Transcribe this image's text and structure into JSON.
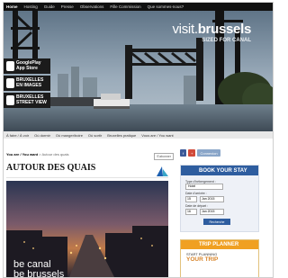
{
  "topnav": {
    "home": "Home",
    "items": [
      "Hosting",
      "Guide",
      "Presse",
      "Observations",
      "Fille Commission",
      "Que sommes-nous?"
    ]
  },
  "hero": {
    "logo_prefix": "visit.",
    "logo_brand": "brussels",
    "logo_sub": "SIZED FOR CANAL",
    "badges": [
      {
        "line1": "GooglePlay",
        "line2": "App Store"
      },
      {
        "line1": "BRUXELLES",
        "line2": "EN IMAGES"
      },
      {
        "line1": "BRUXELLES",
        "line2": "STREET VIEW"
      }
    ]
  },
  "strip": {
    "items": [
      "À faire / À voir",
      "Où dormir",
      "Où manger/boire",
      "Où sortir",
      "Bruxelles pratique",
      "Vous are / You want"
    ]
  },
  "breadcrumb": {
    "lead": "You are / You want",
    "trail": "Autour des quais"
  },
  "toolbar": {
    "b1": "f",
    "b2": "+",
    "b3": "Connexion"
  },
  "article": {
    "title": "AUTOUR DES QUAIS",
    "subscribe": "S'abonner",
    "caption_line1": "be canal",
    "caption_line2": "be brussels"
  },
  "book": {
    "header": "BOOK YOUR STAY",
    "type_label": "Type d'hébergement :",
    "type_value": "Hotel",
    "arrival_label": "Date d'arrivée :",
    "departure_label": "Date de départ :",
    "arrival_day": "15",
    "arrival_month": "Jan 2015",
    "departure_day": "16",
    "departure_month": "Jan 2015",
    "search_label": "Recherche"
  },
  "trip": {
    "header": "TRIP PLANNER",
    "line1": "START PLANNING",
    "line2": "YOUR TRIP"
  },
  "colors": {
    "accent_blue": "#2e5d9f",
    "accent_orange": "#f0a022"
  }
}
